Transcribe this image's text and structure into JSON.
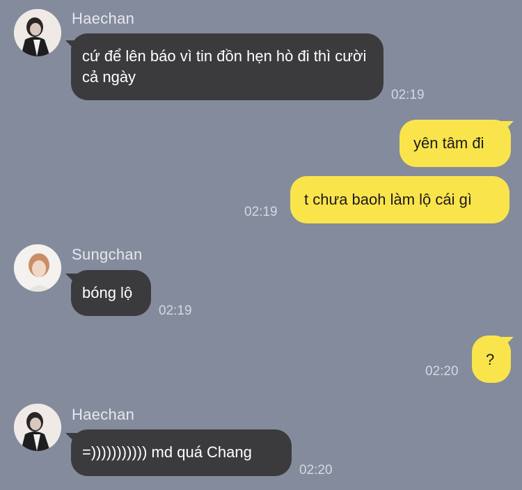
{
  "messages": [
    {
      "sender": "Haechan",
      "text": "cứ để lên báo vì tin đồn hẹn hò đi thì cười cả ngày",
      "time": "02:19"
    },
    {
      "text": "yên tâm đi"
    },
    {
      "text": "t chưa baoh làm lộ cái gì",
      "time": "02:19"
    },
    {
      "sender": "Sungchan",
      "text": "bóng lộ",
      "time": "02:19"
    },
    {
      "text": "?",
      "time": "02:20"
    },
    {
      "sender": "Haechan",
      "text": "=))))))))))) md quá Chang",
      "time": "02:20"
    }
  ],
  "colors": {
    "background": "#848b9c",
    "incoming_bubble": "#3b3b3e",
    "outgoing_bubble": "#fae44c"
  }
}
